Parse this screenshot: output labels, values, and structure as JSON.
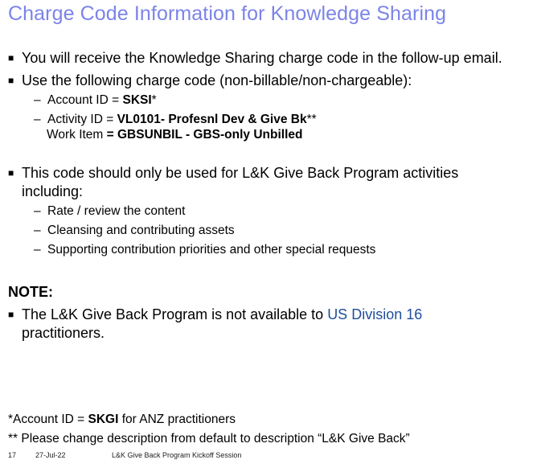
{
  "title": "Charge Code Information for Knowledge Sharing",
  "bullets": {
    "b1": "You will receive the Knowledge Sharing charge code in the follow-up email.",
    "b2": "Use the following charge code (non-billable/non-chargeable):",
    "account_prefix": "Account ID  = ",
    "account_value": "SKSI",
    "account_suffix": "*",
    "activity_prefix": "Activity ID = ",
    "activity_value": "VL0101- Profesnl Dev & Give Bk",
    "activity_suffix": "**",
    "work_prefix": "Work Item ",
    "work_value": "= GBSUNBIL - GBS-only Unbilled",
    "b3_line1": "This code should only be used for L&K Give Back Program activities",
    "b3_line2": "including:",
    "sub1": "Rate / review the content",
    "sub2": "Cleansing and contributing assets",
    "sub3": "Supporting contribution priorities and other special requests"
  },
  "note": {
    "heading": "NOTE:",
    "line1_prefix": "The L&K Give Back Program is not available to ",
    "line1_link": "US Division 16",
    "line2": "practitioners."
  },
  "footnotes": {
    "f1_prefix": "*Account ID = ",
    "f1_value": "SKGI",
    "f1_suffix": " for ANZ practitioners",
    "f2": "** Please change description from default to description “L&K Give Back”"
  },
  "footer": {
    "page": "17",
    "date": "27-Jul-22",
    "session": "L&K Give Back Program Kickoff Session"
  },
  "colors": {
    "title": "#7b84e8",
    "link": "#1f4e9a"
  }
}
